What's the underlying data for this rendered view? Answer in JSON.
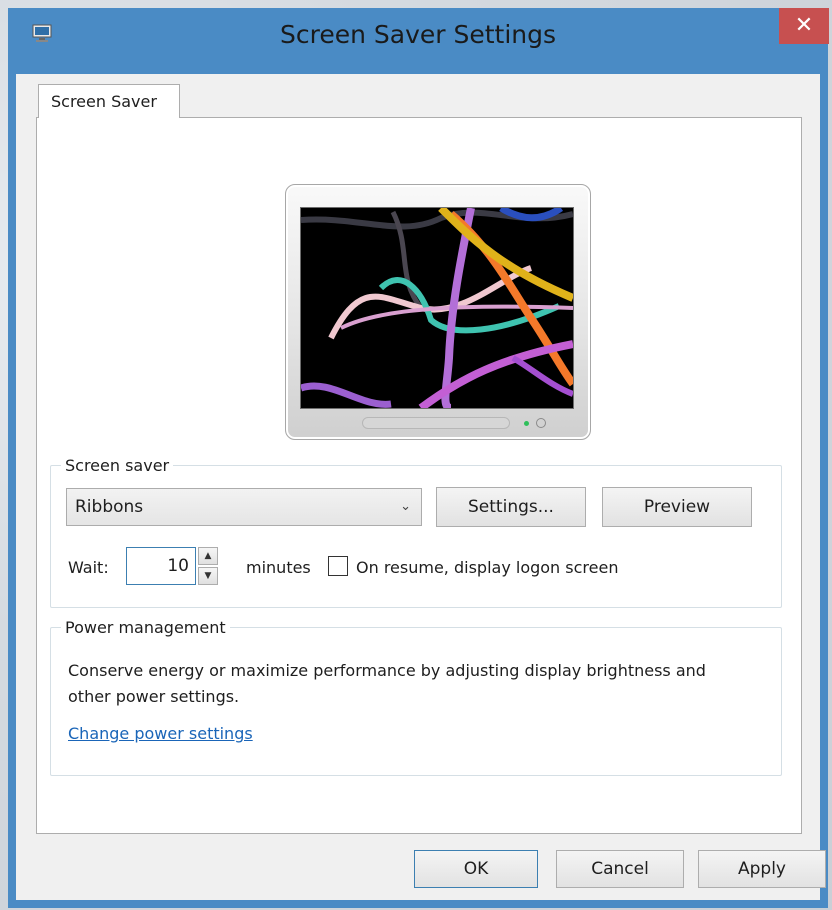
{
  "window": {
    "title": "Screen Saver Settings",
    "close_glyph": "✕",
    "accent_color": "#4a8bc5",
    "close_color": "#c75050"
  },
  "tabs": [
    {
      "label": "Screen Saver",
      "selected": true
    }
  ],
  "screen_saver": {
    "group_label": "Screen saver",
    "selected": "Ribbons",
    "dropdown_icon": "chevron-down-icon",
    "settings_label": "Settings...",
    "preview_label": "Preview",
    "wait_label": "Wait:",
    "wait_value": "10",
    "minutes_label": "minutes",
    "resume_checkbox_label": "On resume, display logon screen",
    "resume_checked": false
  },
  "power_management": {
    "group_label": "Power management",
    "description": "Conserve energy or maximize performance by adjusting display brightness and other power settings.",
    "link_label": "Change power settings"
  },
  "footer": {
    "ok_label": "OK",
    "cancel_label": "Cancel",
    "apply_label": "Apply"
  }
}
